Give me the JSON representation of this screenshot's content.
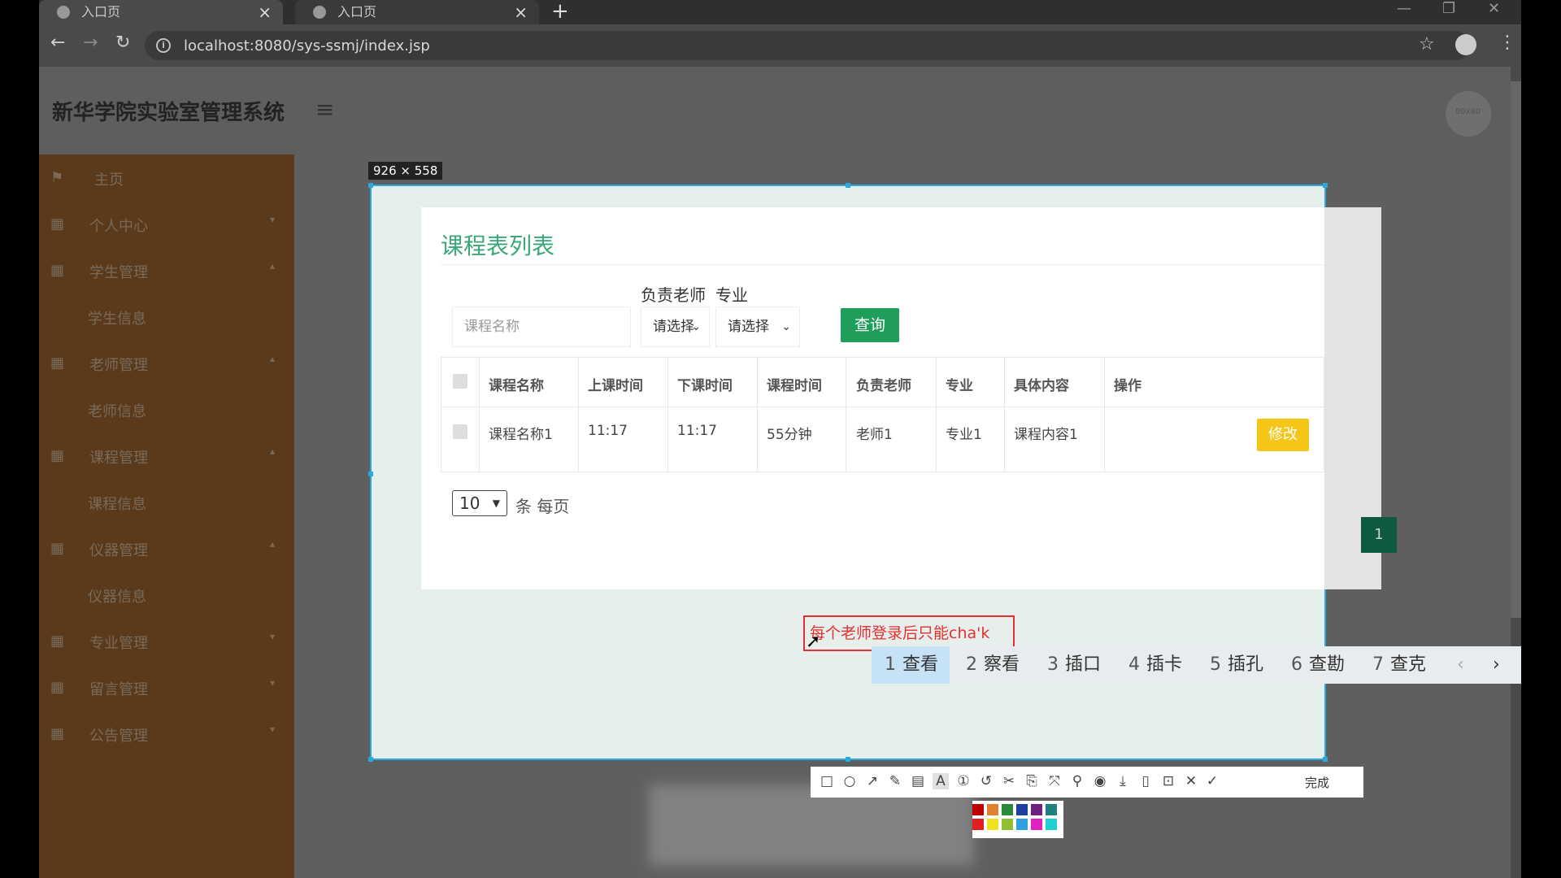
{
  "browser": {
    "tabs": [
      {
        "label": "入口页",
        "close": "×"
      },
      {
        "label": "入口页",
        "close": "×"
      }
    ],
    "new_tab": "+",
    "url": "localhost:8080/sys-ssmj/index.jsp",
    "window_controls": [
      "—",
      "❐",
      "✕"
    ]
  },
  "app": {
    "title": "新华学院实验室管理系统",
    "avatar_text": "80x80"
  },
  "sidebar": {
    "items": [
      {
        "label": "主页",
        "icon": "flag-icon"
      },
      {
        "label": "个人中心",
        "icon": "grid-icon"
      },
      {
        "label": "学生管理",
        "icon": "grid-icon"
      },
      {
        "label": "学生信息"
      },
      {
        "label": "老师管理",
        "icon": "grid-icon"
      },
      {
        "label": "老师信息"
      },
      {
        "label": "课程管理",
        "icon": "grid-icon"
      },
      {
        "label": "课程信息"
      },
      {
        "label": "仪器管理",
        "icon": "grid-icon"
      },
      {
        "label": "仪器信息"
      },
      {
        "label": "专业管理",
        "icon": "grid-icon"
      },
      {
        "label": "留言管理",
        "icon": "grid-icon"
      },
      {
        "label": "公告管理",
        "icon": "grid-icon"
      }
    ]
  },
  "capture": {
    "dimensions": "926 × 558",
    "done_label": "完成"
  },
  "list": {
    "title": "课程表列表",
    "filter_teacher_label": "负责老师",
    "filter_major_label": "专业",
    "course_name_placeholder": "课程名称",
    "teacher_select": "请选择",
    "major_select": "请选择",
    "query_label": "查询",
    "columns": [
      "课程名称",
      "上课时间",
      "下课时间",
      "课程时间",
      "负责老师",
      "专业",
      "具体内容",
      "操作"
    ],
    "rows": [
      {
        "name": "课程名称1",
        "start": "11:17",
        "end": "11:17",
        "duration": "55分钟",
        "teacher": "老师1",
        "major": "专业1",
        "content": "课程内容1",
        "action": "修改"
      }
    ],
    "page_size": "10",
    "page_size_label": "条 每页",
    "page_current": "1"
  },
  "annotation_text": "每个老师登录后只能cha'k",
  "ime": {
    "candidates": [
      {
        "num": "1",
        "text": "查看"
      },
      {
        "num": "2",
        "text": "察看"
      },
      {
        "num": "3",
        "text": "插口"
      },
      {
        "num": "4",
        "text": "插卡"
      },
      {
        "num": "5",
        "text": "插孔"
      },
      {
        "num": "6",
        "text": "查勘"
      },
      {
        "num": "7",
        "text": "查克"
      }
    ]
  },
  "colors": {
    "accent_green": "#1e9e5a",
    "title_green": "#3aa877",
    "edit_yellow": "#f5c518",
    "selection_blue": "#2aa8e0",
    "annotation_red": "#e53030"
  }
}
